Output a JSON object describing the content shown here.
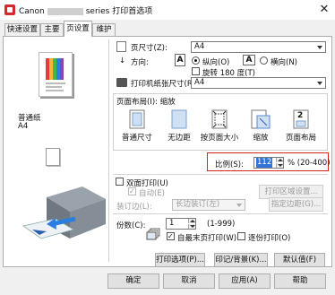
{
  "window": {
    "title_prefix": "Canon",
    "title_suffix": "series 打印首选项",
    "close": "✕"
  },
  "tabs": [
    {
      "label": "快速设置"
    },
    {
      "label": "主要"
    },
    {
      "label": "页设置",
      "active": true
    },
    {
      "label": "维护"
    }
  ],
  "preview": {
    "media_type": "普通纸",
    "paper_size": "A4"
  },
  "page_size": {
    "label": "页尺寸(Z):",
    "value": "A4"
  },
  "orientation": {
    "label": "方向:",
    "portrait": "纵向(O)",
    "landscape": "横向(N)",
    "selected": "portrait",
    "rotate_label": "旋转 180 度(T)",
    "rotate_checked": false,
    "portrait_icon": "A",
    "landscape_icon": "A"
  },
  "printer_paper_size": {
    "label": "打印机纸张尺寸(R):",
    "value": "A4"
  },
  "page_layout": {
    "group_label": "页面布局(I): 缩放",
    "options": [
      {
        "label": "普通尺寸",
        "icon": "normal-size-icon"
      },
      {
        "label": "无边距",
        "icon": "borderless-icon"
      },
      {
        "label": "按页面大小",
        "icon": "fit-to-page-icon"
      },
      {
        "label": "缩放",
        "icon": "scaled-icon",
        "selected": true
      },
      {
        "label": "页面布局",
        "icon": "page-layout-icon",
        "badge": "2"
      }
    ]
  },
  "scaling": {
    "label": "比例(S):",
    "value": "112",
    "unit_range": "% (20-400)"
  },
  "duplex": {
    "label": "双面打印(U)",
    "checked": false,
    "auto_label": "自动(E)",
    "auto_checked": true,
    "area_button": "打印区域设置...",
    "binding_label": "装订边(L):",
    "binding_value": "长边装订(左)",
    "margin_button": "指定边距(G)..."
  },
  "copies": {
    "label": "份数(C):",
    "value": "1",
    "range": "(1-999)",
    "last_page_first": "自最末页打印(W)",
    "last_page_first_checked": true,
    "collate": "逐份打印(O)",
    "collate_checked": false
  },
  "option_buttons": {
    "print_options": "打印选项(P)...",
    "stamp_background": "印记/背景(K)...",
    "defaults": "默认值(F)"
  },
  "dialog_buttons": {
    "ok": "确定",
    "cancel": "取消",
    "apply": "应用(A)",
    "help": "帮助"
  },
  "colors": {
    "accent": "#3173d6",
    "highlight_border": "#d9261c"
  }
}
